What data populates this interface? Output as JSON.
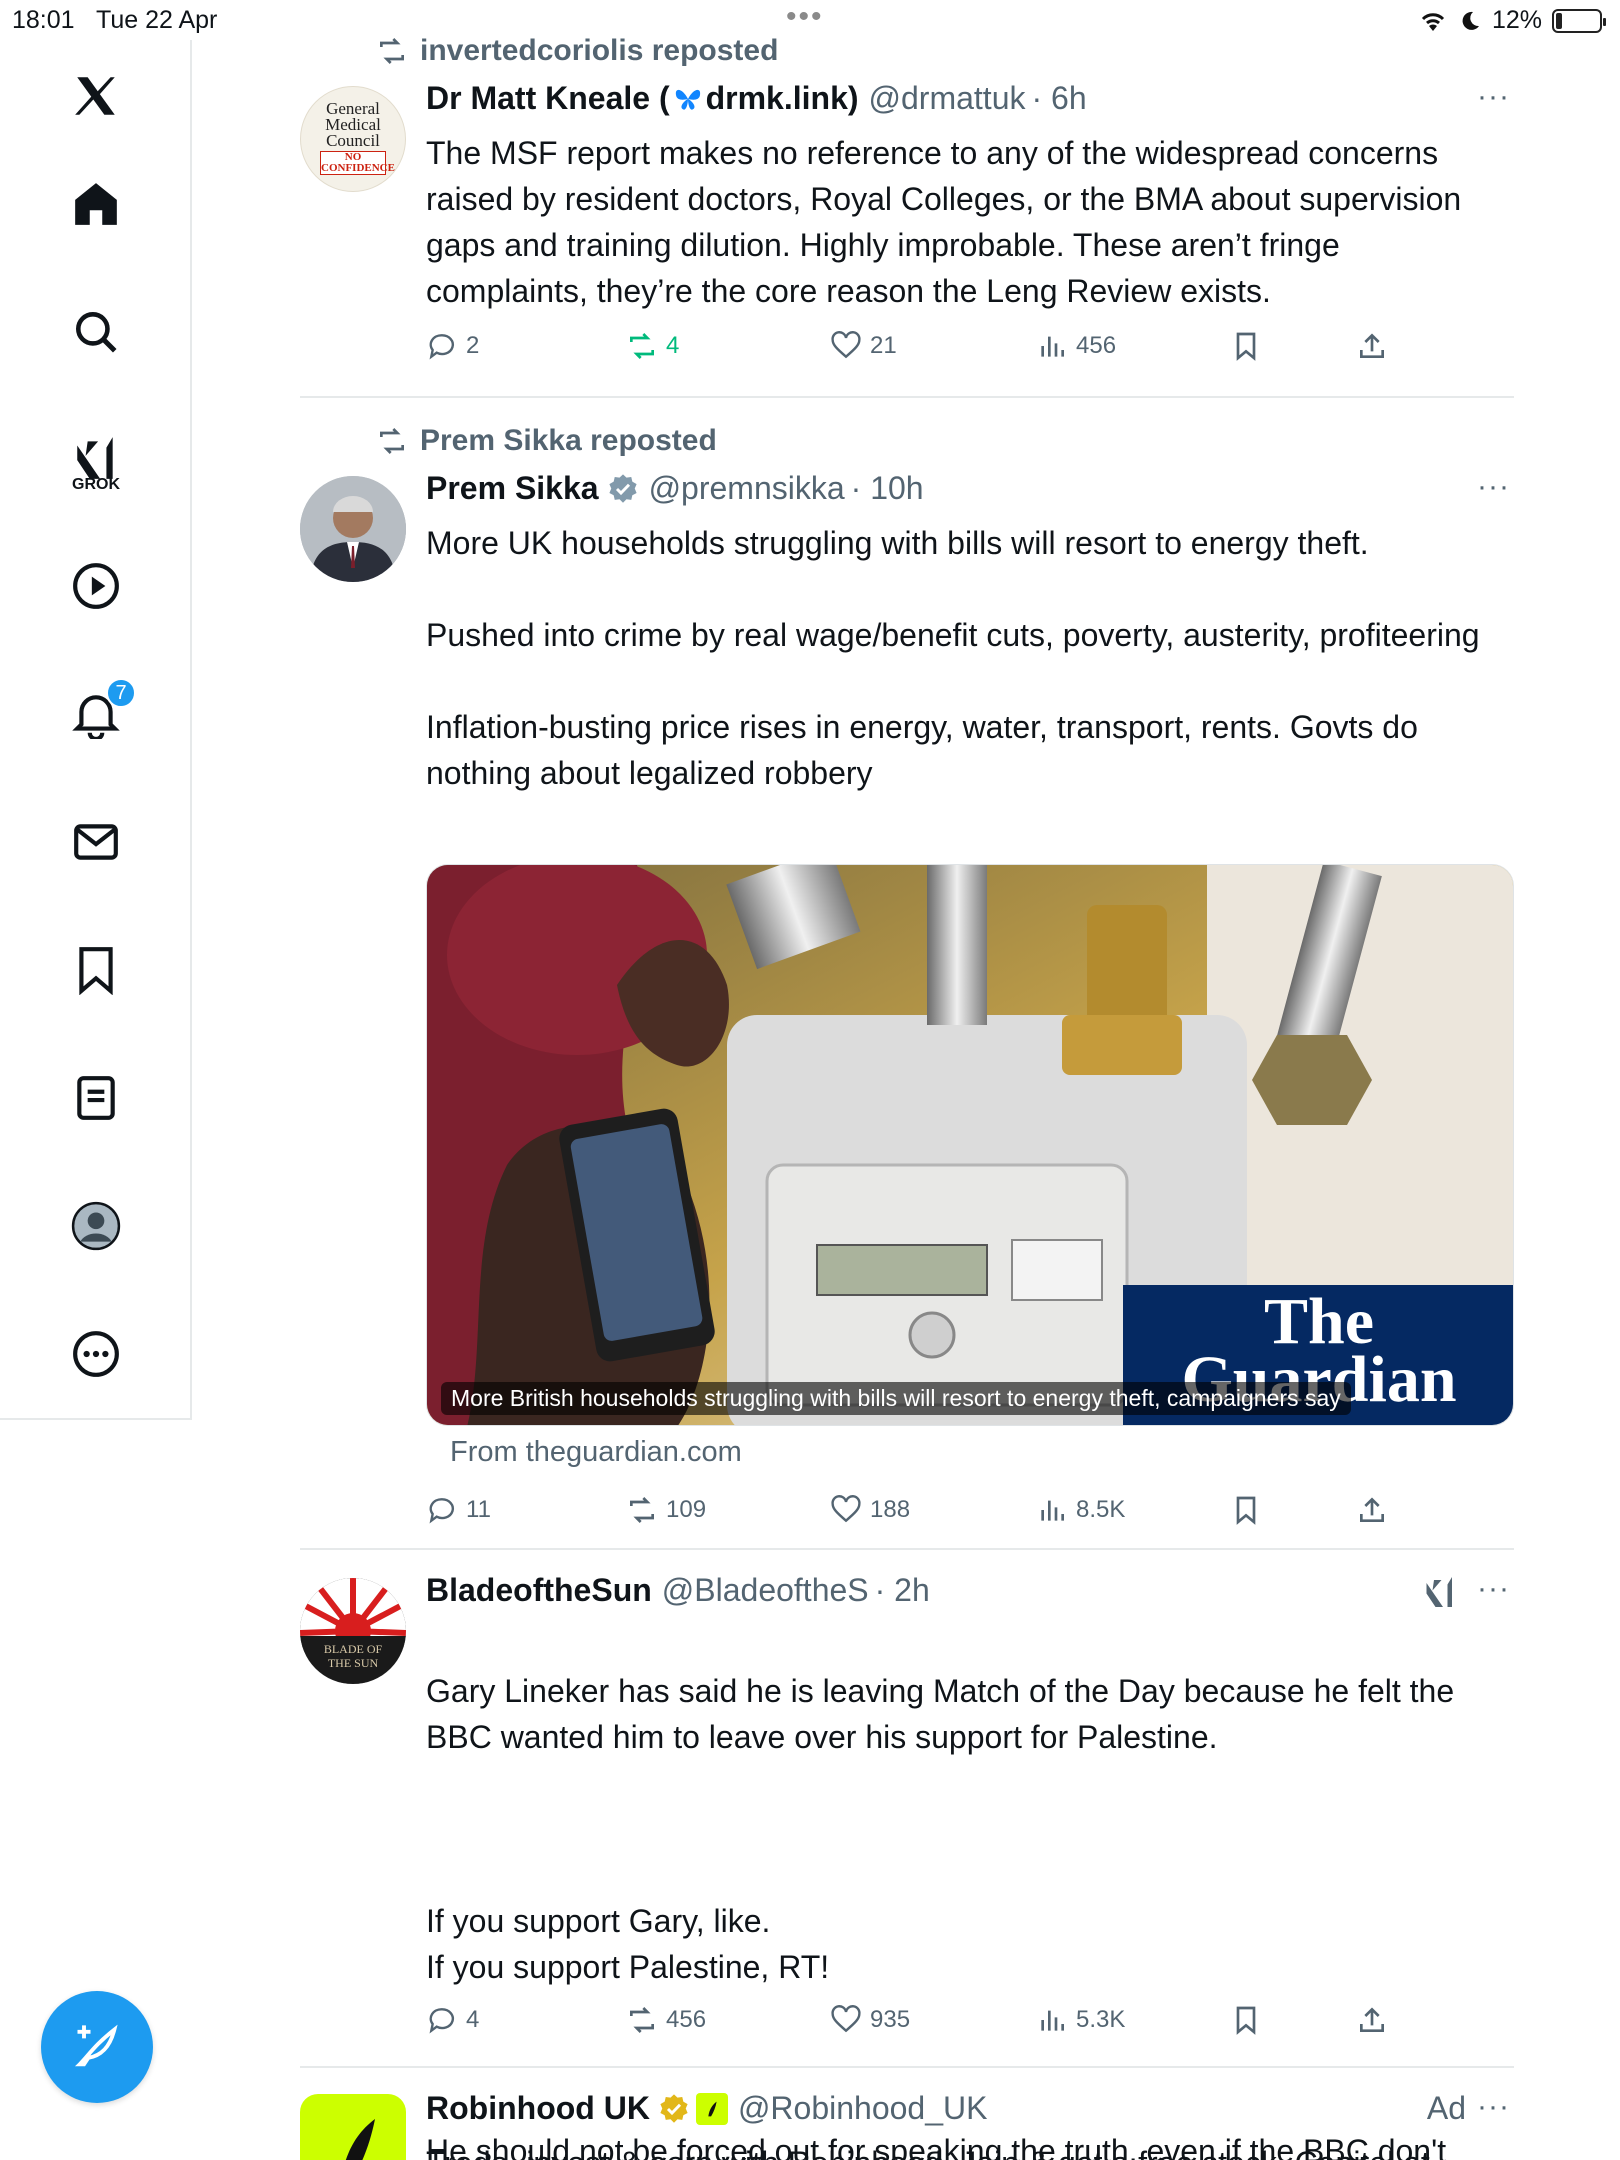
{
  "status_bar": {
    "time": "18:01",
    "date": "Tue 22 Apr",
    "battery": "12%",
    "dots": "•••"
  },
  "sidebar": {
    "grok_label": "GROK",
    "notifications_badge": "7"
  },
  "posts": [
    {
      "reposted_by": "invertedcoriolis reposted",
      "avatar_text": {
        "line1": "General",
        "line2": "Medical",
        "line3": "Council",
        "line4": "NO",
        "line5": "CONFIDENCE"
      },
      "name_prefix": "Dr Matt Kneale (",
      "name_suffix": "drmk.link)",
      "handle": "@drmattuk",
      "time": "· 6h",
      "text": "The MSF report makes no reference to any of the widespread concerns raised by resident doctors, Royal Colleges, or the BMA about supervision gaps and training dilution. Highly improbable. These aren’t fringe complaints, they’re the core reason the Leng Review exists.",
      "replies": "2",
      "reposts": "4",
      "likes": "21",
      "views": "456"
    },
    {
      "reposted_by": "Prem Sikka reposted",
      "name": "Prem Sikka",
      "handle": "@premnsikka",
      "time": "· 10h",
      "paragraphs": [
        "More UK households struggling with bills will resort to energy theft.",
        "Pushed into crime by real wage/benefit cuts, poverty, austerity, profiteering",
        "Inflation-busting price rises in energy, water, transport, rents. Govts do nothing about legalized robbery"
      ],
      "card_caption": "More British households struggling with bills will resort to energy theft, campaigners say",
      "card_logo_line1": "The",
      "card_logo_line2": "Guardian",
      "source": "From theguardian.com",
      "replies": "11",
      "reposts": "109",
      "likes": "188",
      "views": "8.5K"
    },
    {
      "name": "BladeoftheSun",
      "handle": "@BladeoftheS",
      "time": "· 2h",
      "avatar_text": "BLADE OF THE SUN",
      "paragraphs": [
        "Gary Lineker has said he is leaving Match of the Day because he felt the BBC wanted him to leave over his support for Palestine.",
        "If you support Gary, like.\nIf you support Palestine, RT!",
        "He should not be forced out for speaking the truth, even if the BBC don't want to hear it."
      ],
      "replies": "4",
      "reposts": "456",
      "likes": "935",
      "views": "5.3K"
    },
    {
      "name": "Robinhood UK",
      "handle": "@Robinhood_UK",
      "ad_label": "Ad",
      "text": "Trade, invest & earn with Robinhood. Join & get a free stock. Capital at"
    }
  ],
  "colors": {
    "accent": "#1d9bf0",
    "repost_green": "#00ba7c",
    "muted": "#536471",
    "robinhood": "#ccff00"
  }
}
